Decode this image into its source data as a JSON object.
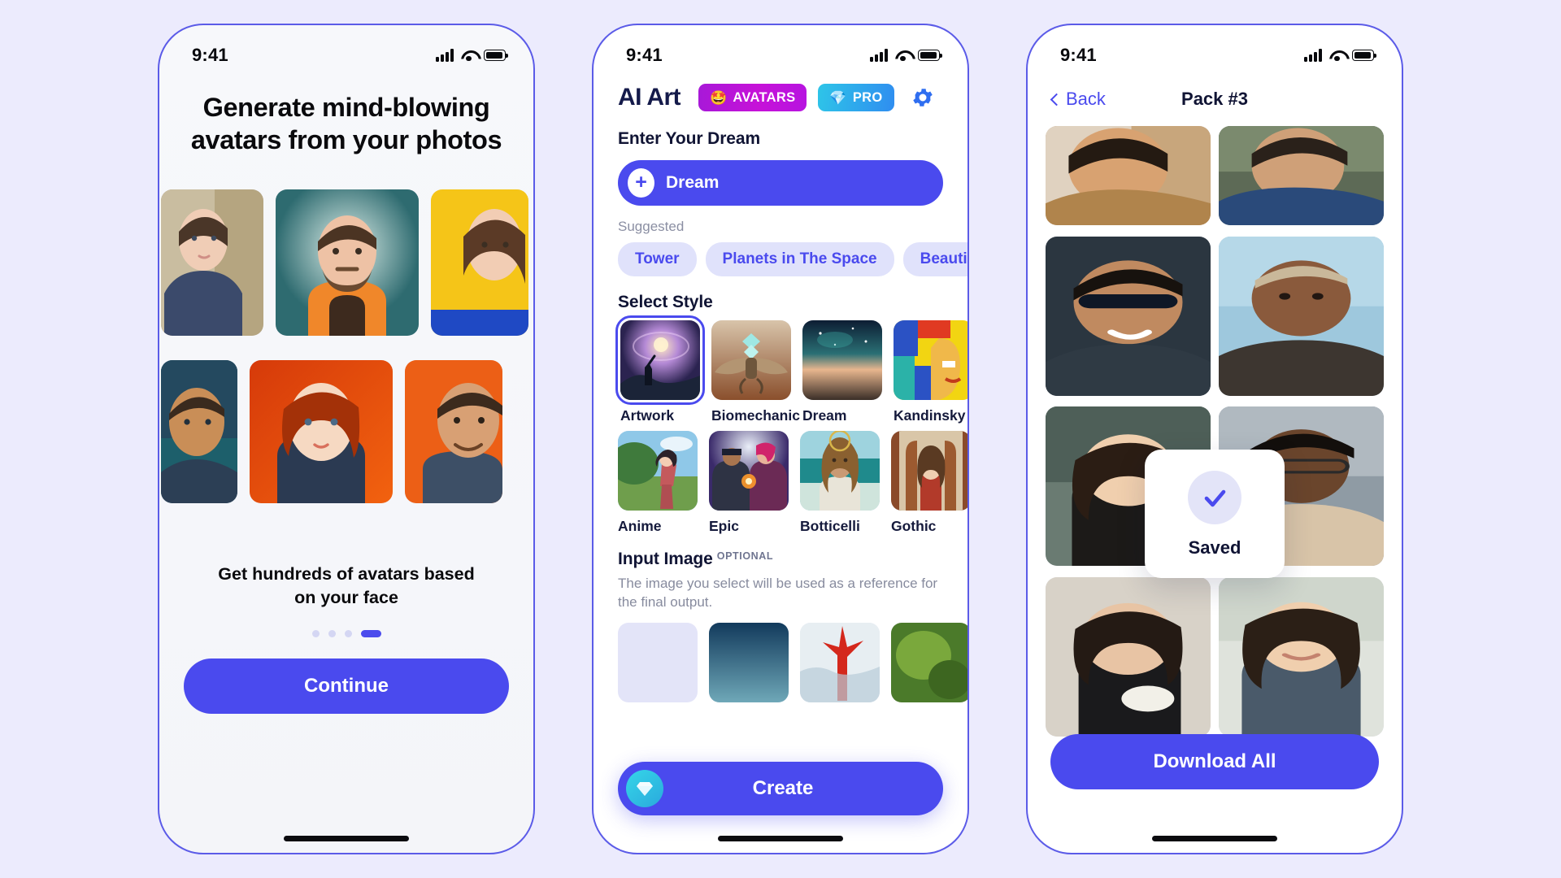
{
  "canvas": {
    "background": "#ecebfd",
    "accent": "#4a4aee"
  },
  "status_bar": {
    "time": "9:41",
    "signal_icon": "cellular-bars-icon",
    "wifi_icon": "wifi-icon",
    "battery_icon": "battery-icon"
  },
  "screen_onboarding": {
    "title": "Generate mind-blowing avatars from your photos",
    "subtitle": "Get hundreds of avatars based on your face",
    "pager": {
      "total": 4,
      "active_index": 3
    },
    "continue_label": "Continue"
  },
  "screen_generator": {
    "logo": "AI Art",
    "badges": [
      {
        "label": "AVATARS",
        "emoji": "🤩",
        "color": "#c612d8"
      },
      {
        "label": "PRO",
        "emoji": "💎",
        "color": "#2f8df0"
      }
    ],
    "settings_icon": "gear-icon",
    "dream": {
      "section_title": "Enter Your Dream",
      "placeholder": "Dream",
      "add_icon": "plus-icon",
      "value": ""
    },
    "suggested": {
      "label": "Suggested",
      "chips": [
        "Tower",
        "Planets in The Space",
        "Beautiful Women"
      ]
    },
    "style": {
      "section_title": "Select Style",
      "selected": "Artwork",
      "items": [
        {
          "label": "Artwork",
          "selected": true
        },
        {
          "label": "Biomechanic",
          "selected": false
        },
        {
          "label": "Dream",
          "selected": false
        },
        {
          "label": "Kandinsky",
          "selected": false
        },
        {
          "label": "Anime",
          "selected": false
        },
        {
          "label": "Epic",
          "selected": false
        },
        {
          "label": "Botticelli",
          "selected": false
        },
        {
          "label": "Gothic",
          "selected": false
        }
      ]
    },
    "input_image": {
      "section_title": "Input Image",
      "optional_tag": "OPTIONAL",
      "hint": "The image you select will be used as a reference for the final output."
    },
    "create_label": "Create",
    "create_icon": "diamond-icon"
  },
  "screen_pack": {
    "back_label": "Back",
    "back_icon": "chevron-left-icon",
    "title": "Pack #3",
    "toast": {
      "label": "Saved",
      "icon": "check-icon"
    },
    "download_label": "Download All"
  }
}
